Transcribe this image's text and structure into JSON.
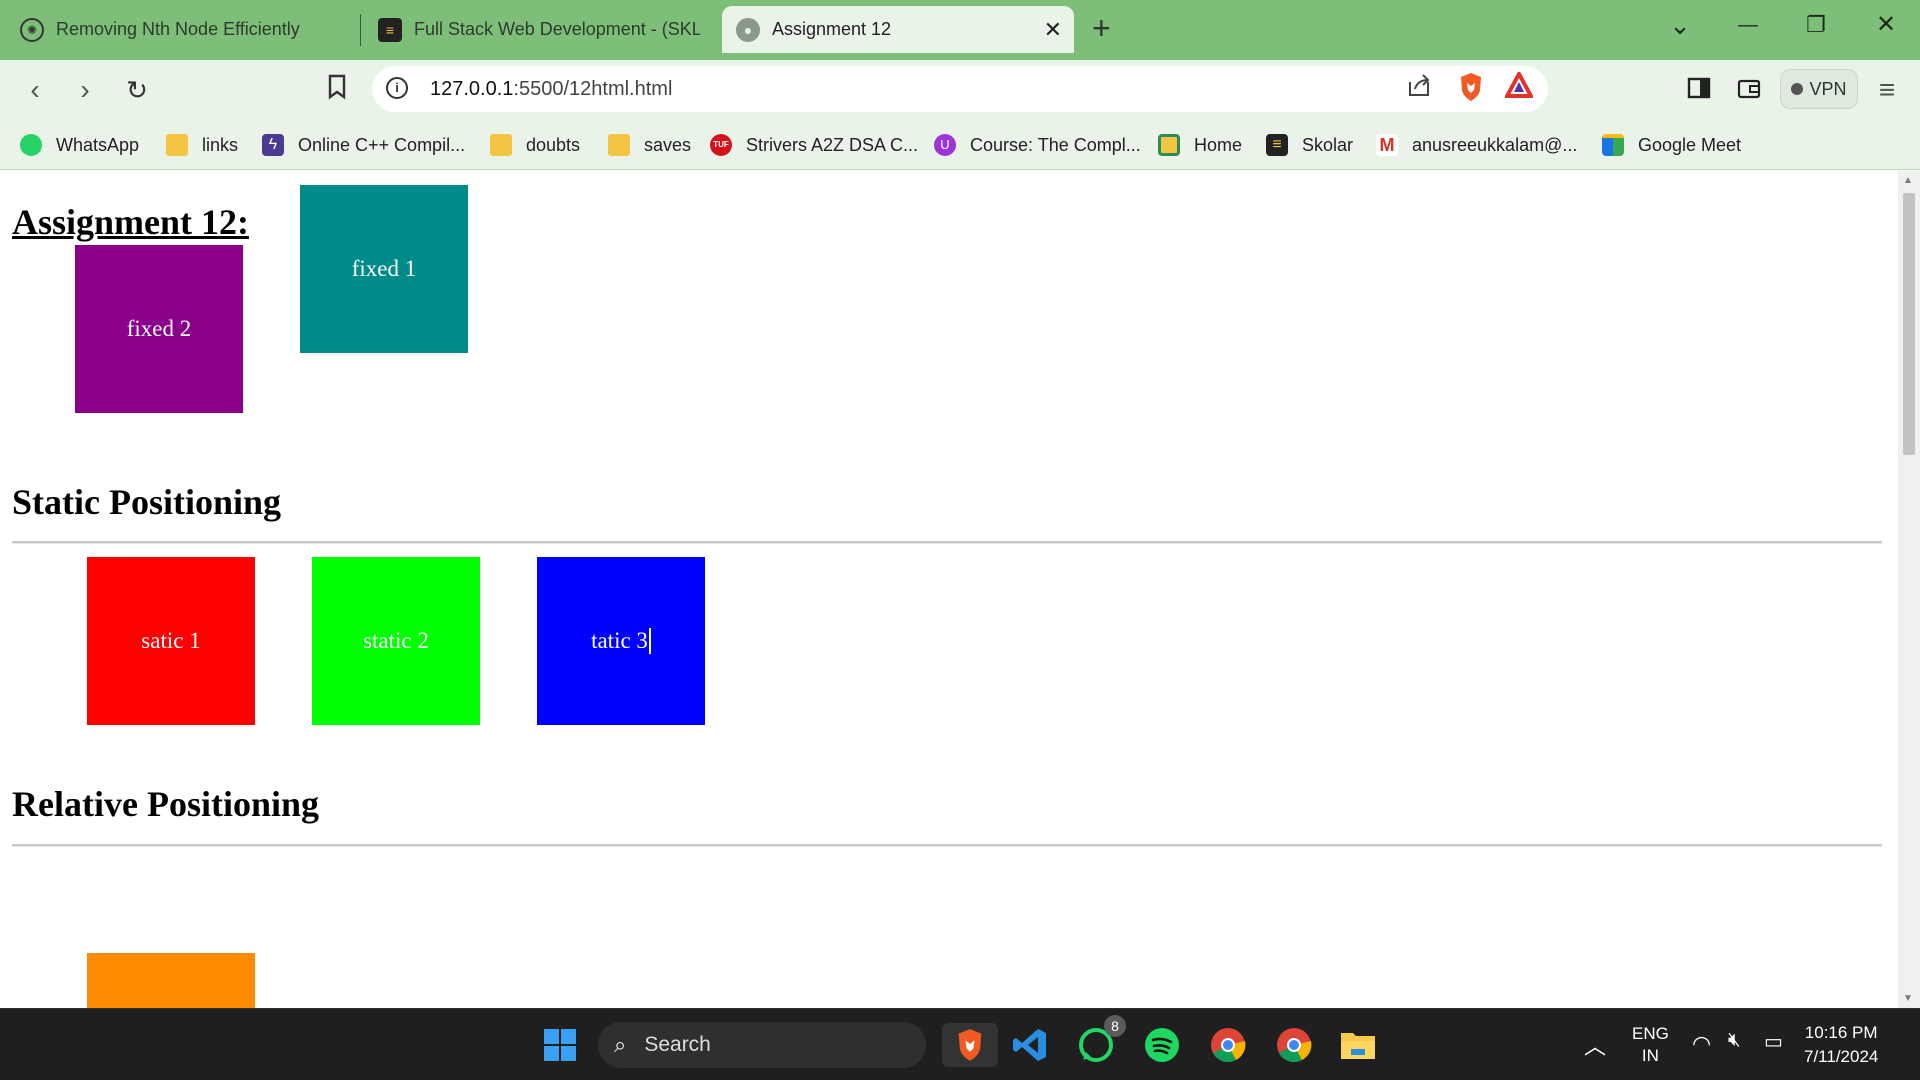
{
  "tabs": [
    {
      "title": "Removing Nth Node Efficiently",
      "icon": "chatgpt-icon"
    },
    {
      "title": "Full Stack Web Development - (SKLR",
      "icon": "skolar-icon"
    },
    {
      "title": "Assignment 12",
      "icon": "globe-icon",
      "active": true
    }
  ],
  "window": {
    "new_tab": "+",
    "menu": "⌄",
    "minimize": "—",
    "restore": "❐",
    "close": "✕",
    "tab_close": "✕"
  },
  "toolbar": {
    "url_host": "127.0.0.1",
    "url_rest": ":5500/12html.html",
    "vpn_label": "VPN"
  },
  "bookmarks": [
    {
      "label": "WhatsApp",
      "icon": "whatsapp-icon"
    },
    {
      "label": "links",
      "icon": "folder-icon"
    },
    {
      "label": "Online C++ Compil...",
      "icon": "bolt-icon"
    },
    {
      "label": "doubts",
      "icon": "folder-icon"
    },
    {
      "label": "saves",
      "icon": "folder-icon"
    },
    {
      "label": "Strivers A2Z DSA C...",
      "icon": "tuf-icon"
    },
    {
      "label": "Course: The Compl...",
      "icon": "udemy-icon"
    },
    {
      "label": "Home",
      "icon": "classroom-icon"
    },
    {
      "label": "Skolar",
      "icon": "skolar-icon"
    },
    {
      "label": "anusreeukkalam@...",
      "icon": "gmail-icon"
    },
    {
      "label": "Google Meet",
      "icon": "meet-icon"
    }
  ],
  "page": {
    "title": "Assignment 12:",
    "fixed_boxes": [
      {
        "label": "fixed 1",
        "color": "#008b8b"
      },
      {
        "label": "fixed 2",
        "color": "#8b008b"
      }
    ],
    "static_heading": "Static Positioning",
    "static_boxes": [
      {
        "label": "satic 1",
        "color": "#ff0000"
      },
      {
        "label": "static 2",
        "color": "#00ff00"
      },
      {
        "label": "tatic 3",
        "color": "#0000ff"
      }
    ],
    "relative_heading": "Relative Positioning",
    "relative_box_color": "#ff8c00"
  },
  "taskbar": {
    "search_placeholder": "Search",
    "whatsapp_badge": "8",
    "lang_line1": "ENG",
    "lang_line2": "IN",
    "time": "10:16 PM",
    "date": "7/11/2024"
  }
}
